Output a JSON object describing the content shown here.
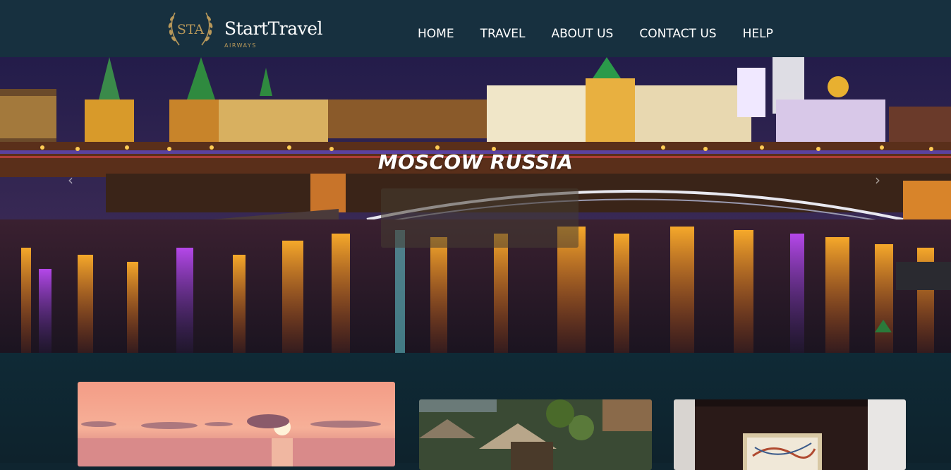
{
  "header": {
    "logo": {
      "monogram": "STA",
      "brand": "StartTravel",
      "tagline": "AIRWAYS"
    },
    "nav": [
      {
        "label": "HOME"
      },
      {
        "label": "TRAVEL"
      },
      {
        "label": "ABOUT US"
      },
      {
        "label": "CONTACT US"
      },
      {
        "label": "HELP"
      }
    ]
  },
  "hero": {
    "caption": "MOSCOW RUSSIA",
    "prev_icon": "chevron-left-icon",
    "next_icon": "chevron-right-icon"
  },
  "cards": [
    {
      "image": "sunset-sea-photo"
    },
    {
      "image": "thatched-huts-photo"
    },
    {
      "image": "interior-room-photo"
    }
  ],
  "colors": {
    "header_bg": "#17303f",
    "page_bg": "#0f2530",
    "logo_gold": "#b8985a",
    "nav_text": "#ffffff"
  }
}
